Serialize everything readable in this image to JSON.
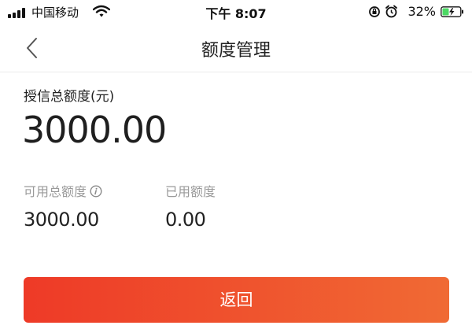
{
  "status_bar": {
    "carrier": "中国移动",
    "time": "下午 8:07",
    "battery_percent": "32%",
    "icons": [
      "signal-icon",
      "wifi-icon",
      "rotation-lock-icon",
      "alarm-icon",
      "battery-charging-icon"
    ],
    "battery_color": "#4cd964"
  },
  "nav": {
    "title": "额度管理",
    "back_icon": "chevron-left-icon"
  },
  "credit": {
    "total_label": "授信总额度(元)",
    "total_amount": "3000.00",
    "available_label": "可用总额度",
    "available_amount": "3000.00",
    "used_label": "已用额度",
    "used_amount": "0.00",
    "info_icon": "info-icon"
  },
  "actions": {
    "return_label": "返回",
    "button_gradient": [
      "#ee3a27",
      "#f06a34"
    ]
  }
}
